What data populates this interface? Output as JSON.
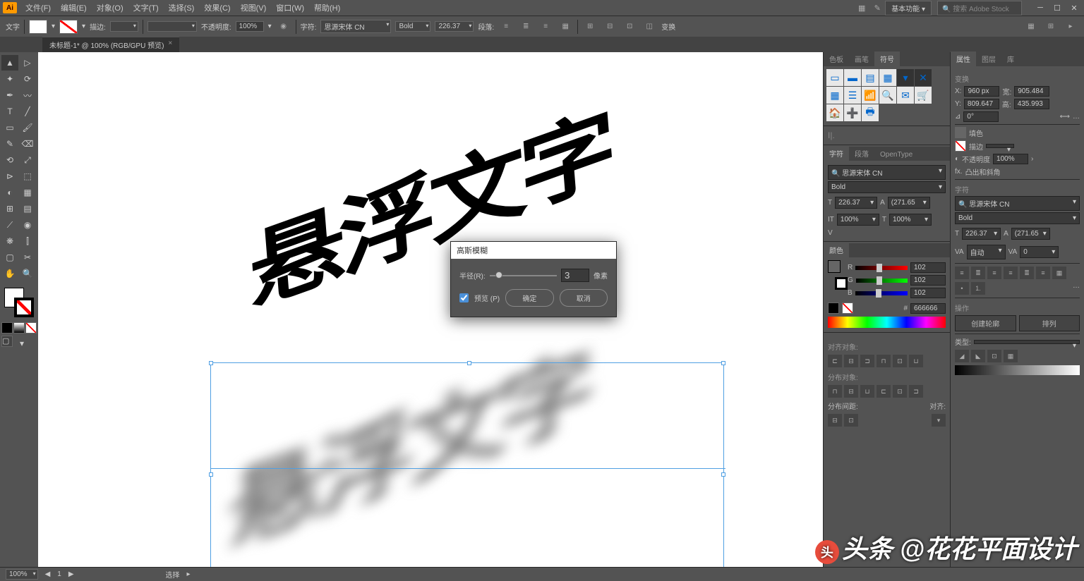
{
  "app": {
    "logo": "Ai"
  },
  "menu": [
    "文件(F)",
    "编辑(E)",
    "对象(O)",
    "文字(T)",
    "选择(S)",
    "效果(C)",
    "视图(V)",
    "窗口(W)",
    "帮助(H)"
  ],
  "workspace": "基本功能",
  "search_ph": "搜索 Adobe Stock",
  "control": {
    "mode": "文字",
    "stroke": "描边:",
    "opacity_lbl": "不透明度:",
    "opacity": "100%",
    "char_lbl": "字符:",
    "font": "思源宋体 CN",
    "weight": "Bold",
    "size": "226.37",
    "para_lbl": "段落:",
    "transform": "变换"
  },
  "doc_tab": "未标题-1* @ 100% (RGB/GPU 预览)",
  "artwork_text": "悬浮文字",
  "dialog": {
    "title": "高斯模糊",
    "radius_lbl": "半径(R):",
    "radius_val": "3",
    "unit": "像素",
    "preview": "预览 (P)",
    "ok": "确定",
    "cancel": "取消"
  },
  "panels": {
    "tabs_a": [
      "色板",
      "画笔",
      "符号"
    ],
    "tabs_b": [
      "属性",
      "图层",
      "库"
    ],
    "tabs_char": [
      "字符",
      "段落",
      "OpenType"
    ],
    "tabs_color": [
      "颜色"
    ],
    "char": {
      "lbl": "字符",
      "font": "思源宋体 CN",
      "weight": "Bold",
      "size": "226.37",
      "leading": "(271.65",
      "tracking": "100%",
      "kerning": "100%",
      "vscale": "V"
    },
    "transform": {
      "lbl": "变换",
      "x": "960 px",
      "y": "809.647",
      "w": "905.484",
      "h": "435.993",
      "angle": "0°"
    },
    "appearance": {
      "fill": "填色",
      "stroke": "描边",
      "opacity_lbl": "不透明度",
      "opacity": "100%",
      "fx": "凸出和斜角"
    },
    "char2": {
      "lbl": "字符",
      "font": "思源宋体 CN",
      "weight": "Bold",
      "size": "226.37",
      "leading": "(271.65",
      "auto": "自动",
      "zero": "0"
    },
    "color": {
      "r": "102",
      "g": "102",
      "b": "102",
      "hex": "666666"
    },
    "align": {
      "obj": "对齐对象:",
      "dist": "分布对象:",
      "spacing": "分布间距:",
      "to": "对齐:"
    },
    "actions": {
      "lbl": "操作",
      "btn1": "创建轮廓",
      "btn2": "排列"
    },
    "type": {
      "lbl": "类型:"
    }
  },
  "status": {
    "zoom": "100%",
    "page": "1",
    "tool": "选择"
  },
  "watermark": "头条 @花花平面设计"
}
